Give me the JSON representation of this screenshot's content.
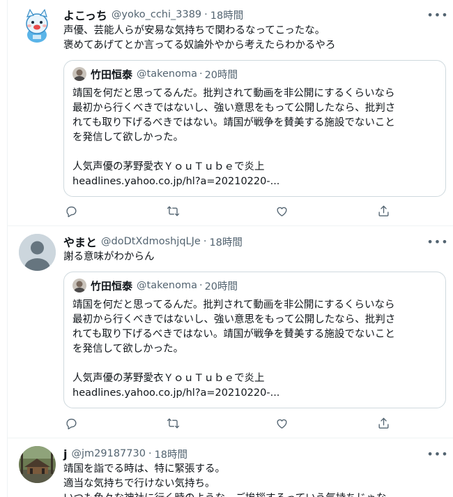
{
  "tweets": [
    {
      "name": "よこっち",
      "handle": "@yoko_cchi_3389",
      "separator": "·",
      "time": "18時間",
      "avatar_icon": "cartoon-character-avatar",
      "lines": [
        "声優、芸能人らが安易な気持ちで関わるなってこったな。",
        "褒めてあげてとか言ってる奴論外やから考えたらわかるやろ"
      ],
      "quote": {
        "name": "竹田恒泰",
        "handle": "@takenoma",
        "separator": "·",
        "time": "20時間",
        "lines": [
          "靖国を何だと思ってるんだ。批判されて動画を非公開にするくらいなら",
          "最初から行くべきではないし、強い意思をもって公開したなら、批判さ",
          "れても取り下げるべきではない。靖国が戦争を賛美する施設でないこと",
          "を発信して欲しかった。",
          "",
          "人気声優の茅野愛衣ＹｏｕＴｕｂｅで炎上",
          " headlines.yahoo.co.jp/hl?a=20210220-..."
        ]
      }
    },
    {
      "name": "やまと",
      "handle": "@doDtXdmoshjqLJe",
      "separator": "·",
      "time": "18時間",
      "avatar_icon": "default-profile-avatar",
      "lines": [
        "謝る意味がわからん"
      ],
      "quote": {
        "name": "竹田恒泰",
        "handle": "@takenoma",
        "separator": "·",
        "time": "20時間",
        "lines": [
          "靖国を何だと思ってるんだ。批判されて動画を非公開にするくらいなら",
          "最初から行くべきではないし、強い意思をもって公開したなら、批判さ",
          "れても取り下げるべきではない。靖国が戦争を賛美する施設でないこと",
          "を発信して欲しかった。",
          "",
          "人気声優の茅野愛衣ＹｏｕＴｕｂｅで炎上",
          " headlines.yahoo.co.jp/hl?a=20210220-..."
        ]
      }
    },
    {
      "name": "j",
      "handle": "@jm29187730",
      "separator": "·",
      "time": "18時間",
      "avatar_icon": "photo-avatar",
      "lines": [
        "靖国を詣でる時は、特に緊張する。",
        "適当な気持ちで行けない気持ち。",
        "いつも色々な神社に行く時のような、ご挨拶するっていう気持ちじゃな"
      ]
    }
  ],
  "actions": {
    "reply_icon": "reply-icon",
    "retweet_icon": "retweet-icon",
    "like_icon": "like-icon",
    "share_icon": "share-icon"
  },
  "more_label": "•••",
  "colors": {
    "text": "#0f1419",
    "secondary": "#536471",
    "border": "#cfd9de",
    "divider": "#eff3f4"
  }
}
